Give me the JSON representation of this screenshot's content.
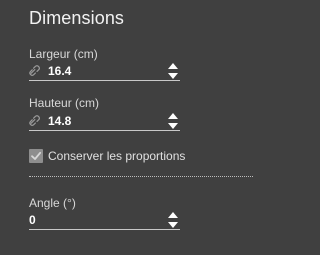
{
  "panel": {
    "title": "Dimensions"
  },
  "fields": {
    "width": {
      "label": "Largeur (cm)",
      "value": "16.4",
      "linked": true
    },
    "height": {
      "label": "Hauteur (cm)",
      "value": "14.8",
      "linked": true
    },
    "angle": {
      "label": "Angle (°)",
      "value": "0"
    }
  },
  "options": {
    "keep_proportions_label": "Conserver les proportions",
    "keep_proportions_checked": true
  },
  "icons": {
    "link": "link-icon",
    "spinner": "up-down-spinner-icon",
    "check": "checkmark-icon"
  },
  "colors": {
    "background": "#404040",
    "text": "#e6e6e6",
    "value": "#ffffff",
    "checkbox": "#8e8e8e"
  }
}
